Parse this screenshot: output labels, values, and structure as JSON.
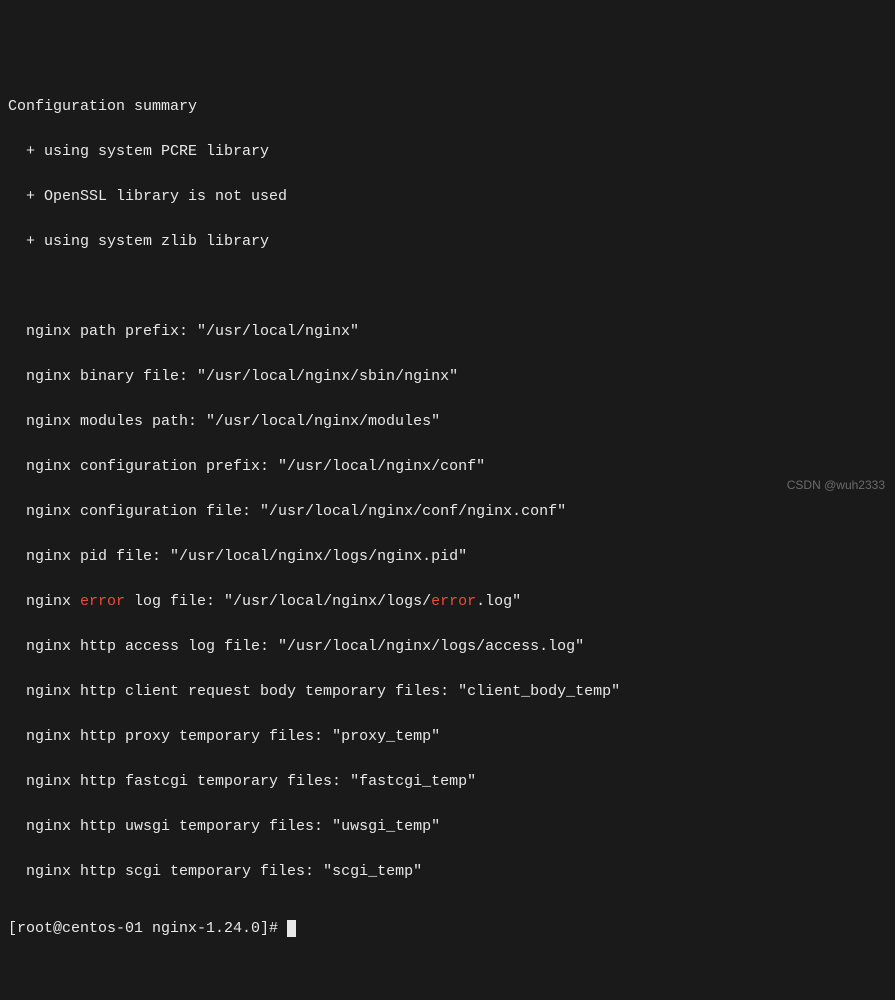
{
  "header": "Configuration summary",
  "bullets": [
    "+ using system PCRE library",
    "+ OpenSSL library is not used",
    "+ using system zlib library"
  ],
  "paths": {
    "prefix": {
      "label": "nginx path prefix: ",
      "value": "\"/usr/local/nginx\""
    },
    "binary": {
      "label": "nginx binary file: ",
      "value": "\"/usr/local/nginx/sbin/nginx\""
    },
    "modules": {
      "label": "nginx modules path: ",
      "value": "\"/usr/local/nginx/modules\""
    },
    "conf_prefix": {
      "label": "nginx configuration prefix: ",
      "value": "\"/usr/local/nginx/conf\""
    },
    "conf_file": {
      "label": "nginx configuration file: ",
      "value": "\"/usr/local/nginx/conf/nginx.conf\""
    },
    "pid_file": {
      "label": "nginx pid file: ",
      "value": "\"/usr/local/nginx/logs/nginx.pid\""
    },
    "error_log": {
      "pre1": "nginx ",
      "err1": "error",
      "mid": " log file: \"/usr/local/nginx/logs/",
      "err2": "error",
      "post": ".log\""
    },
    "access_log": {
      "label": "nginx http access log file: ",
      "value": "\"/usr/local/nginx/logs/access.log\""
    },
    "client_body": {
      "label": "nginx http client request body temporary files: ",
      "value": "\"client_body_temp\""
    },
    "proxy_temp": {
      "label": "nginx http proxy temporary files: ",
      "value": "\"proxy_temp\""
    },
    "fastcgi_temp": {
      "label": "nginx http fastcgi temporary files: ",
      "value": "\"fastcgi_temp\""
    },
    "uwsgi_temp": {
      "label": "nginx http uwsgi temporary files: ",
      "value": "\"uwsgi_temp\""
    },
    "scgi_temp": {
      "label": "nginx http scgi temporary files: ",
      "value": "\"scgi_temp\""
    }
  },
  "prompt": "[root@centos-01 nginx-1.24.0]# ",
  "watermark": "CSDN @wuh2333"
}
